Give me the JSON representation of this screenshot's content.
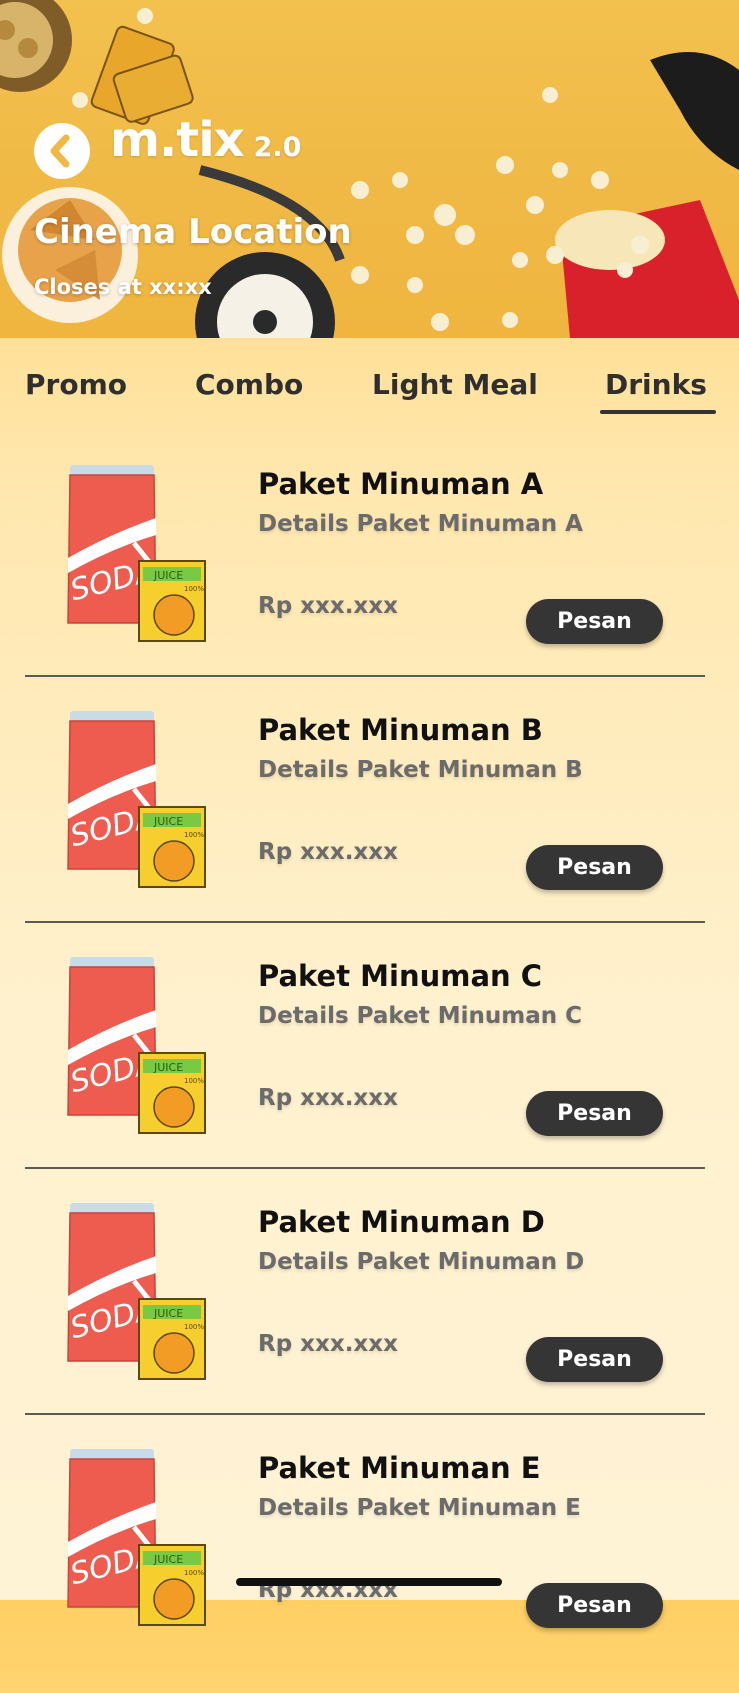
{
  "header": {
    "brand": "m.tix",
    "brand_version": "2.0",
    "cinema_title": "Cinema Location",
    "close_time": "Closes at xx:xx",
    "back_icon": "chevron-left-icon"
  },
  "tabs": [
    {
      "label": "Promo",
      "active": false
    },
    {
      "label": "Combo",
      "active": false
    },
    {
      "label": "Light Meal",
      "active": false
    },
    {
      "label": "Drinks",
      "active": true
    }
  ],
  "products": [
    {
      "name": "Paket Minuman A",
      "details": "Details Paket Minuman A",
      "price": "Rp xxx.xxx",
      "order_label": "Pesan"
    },
    {
      "name": "Paket Minuman B",
      "details": "Details Paket Minuman B",
      "price": "Rp xxx.xxx",
      "order_label": "Pesan"
    },
    {
      "name": "Paket Minuman C",
      "details": "Details Paket Minuman C",
      "price": "Rp xxx.xxx",
      "order_label": "Pesan"
    },
    {
      "name": "Paket Minuman D",
      "details": "Details Paket Minuman D",
      "price": "Rp xxx.xxx",
      "order_label": "Pesan"
    },
    {
      "name": "Paket Minuman E",
      "details": "Details Paket Minuman E",
      "price": "Rp xxx.xxx",
      "order_label": "Pesan"
    }
  ],
  "product_image": {
    "can_text": "SODA",
    "box_text": "JUICE",
    "box_subtext": "100%"
  },
  "colors": {
    "accent": "#ffcf63",
    "button": "#353535",
    "soda_can": "#ee5b4f",
    "juice_box": "#f6cf2e"
  }
}
